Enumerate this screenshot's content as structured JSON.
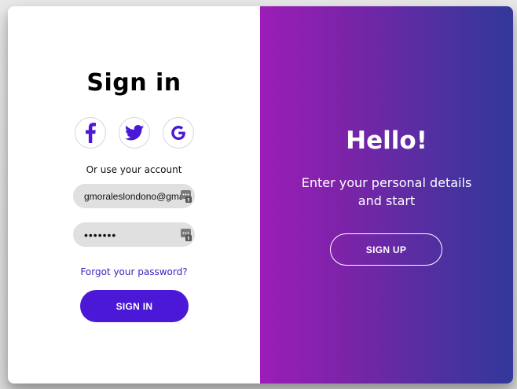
{
  "signin": {
    "title": "Sign in",
    "socials": [
      {
        "name": "facebook",
        "icon": "facebook-icon"
      },
      {
        "name": "twitter",
        "icon": "twitter-icon"
      },
      {
        "name": "google",
        "icon": "google-icon"
      }
    ],
    "alt_text": "Or use your account",
    "email_value": "gmoraleslondono@gmail.com",
    "password_value": "•••••••",
    "forgot_link": "Forgot your password?",
    "submit_label": "SIGN IN"
  },
  "signup_panel": {
    "title": "Hello!",
    "subtitle": "Enter your personal details and start",
    "button_label": "SIGN UP"
  },
  "colors": {
    "accent": "#4a18d6",
    "link": "#3a1fbf",
    "gradient_start": "#9b1db8",
    "gradient_end": "#33389a",
    "field_bg": "#e0e0e0"
  }
}
